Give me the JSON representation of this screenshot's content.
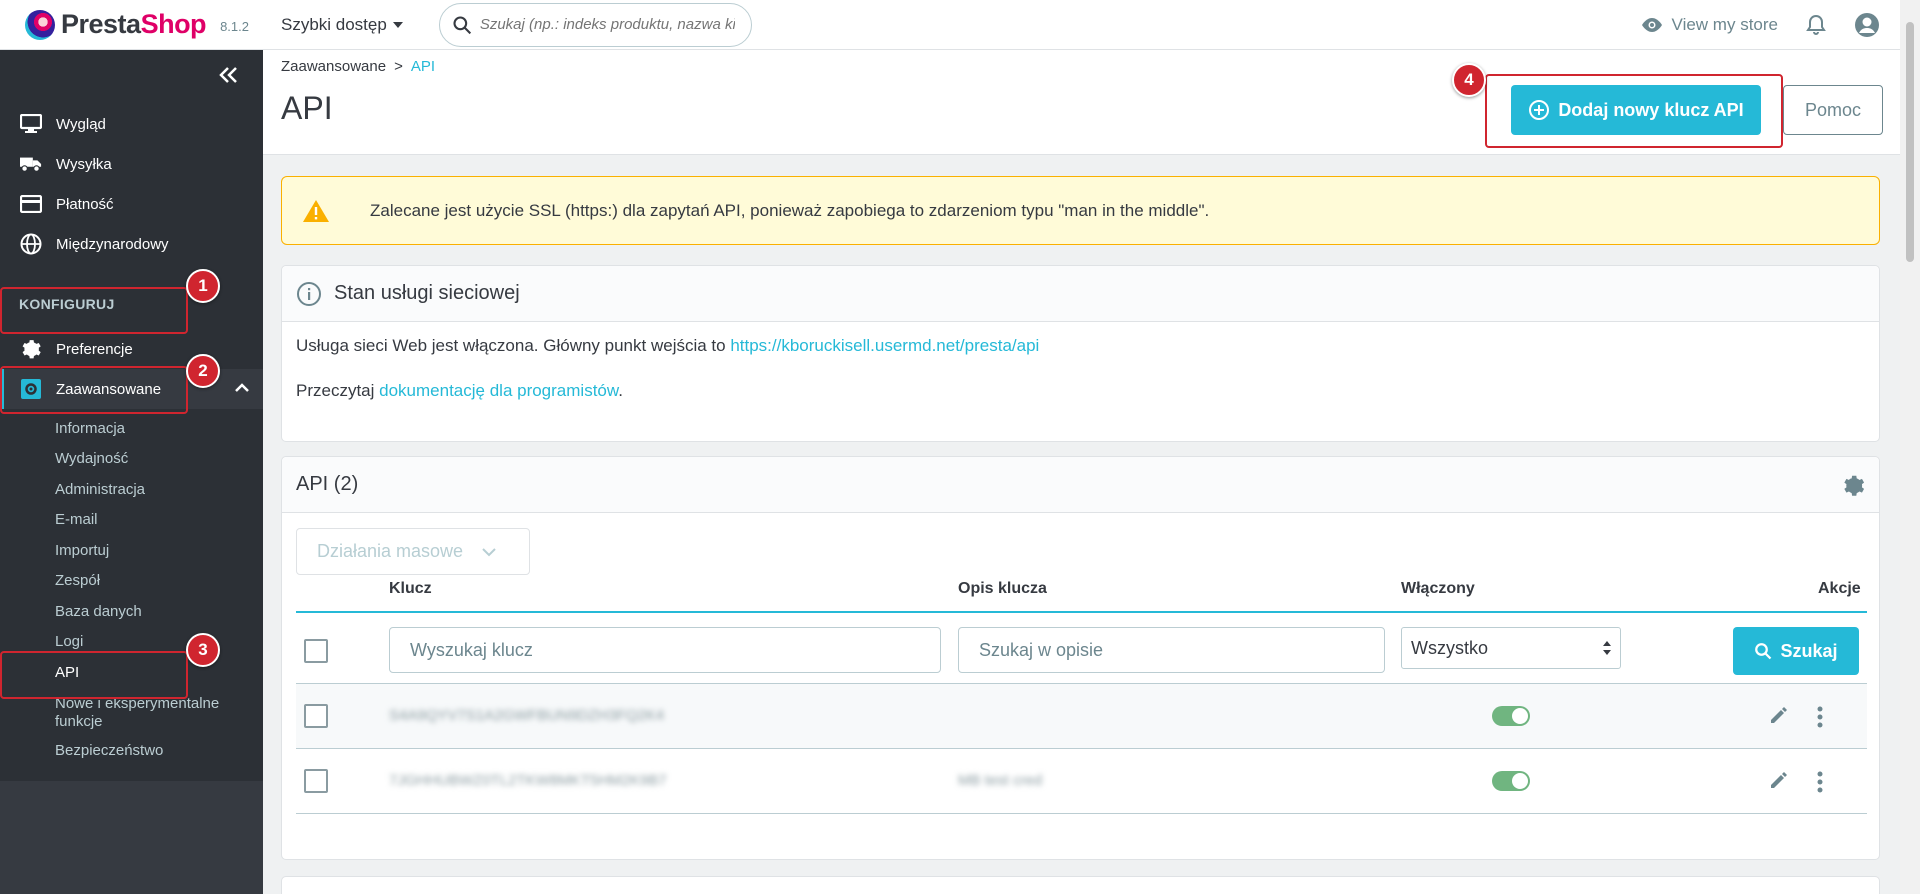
{
  "header": {
    "logo_presta": "Presta",
    "logo_shop": "Shop",
    "version": "8.1.2",
    "quick_access": "Szybki dostęp",
    "search_placeholder": "Szukaj (np.: indeks produktu, nazwa ki",
    "view_store": "View my store"
  },
  "sidebar": {
    "top_items": [
      {
        "label": "Wygląd",
        "icon": "monitor-icon"
      },
      {
        "label": "Wysyłka",
        "icon": "truck-icon"
      },
      {
        "label": "Płatność",
        "icon": "credit-card-icon"
      },
      {
        "label": "Międzynarodowy",
        "icon": "globe-icon"
      }
    ],
    "section_title": "KONFIGURUJ",
    "config_items": [
      {
        "label": "Preferencje",
        "icon": "gear-icon"
      },
      {
        "label": "Zaawansowane",
        "icon": "advanced-settings-icon"
      }
    ],
    "sub_items": [
      "Informacja",
      "Wydajność",
      "Administracja",
      "E-mail",
      "Importuj",
      "Zespół",
      "Baza danych",
      "Logi",
      "API",
      "Nowe i eksperymentalne funkcje",
      "Bezpieczeństwo"
    ]
  },
  "annotations": [
    "1",
    "2",
    "3",
    "4"
  ],
  "page": {
    "breadcrumb_parent": "Zaawansowane",
    "breadcrumb_sep": ">",
    "breadcrumb_current": "API",
    "title": "API",
    "add_button": "Dodaj nowy klucz API",
    "help_button": "Pomoc"
  },
  "alert": {
    "text": "Zalecane jest użycie SSL (https:) dla zapytań API, ponieważ zapobiega to zdarzeniom typu \"man in the middle\"."
  },
  "status_card": {
    "title": "Stan usługi sieciowej",
    "line1_prefix": "Usługa sieci Web jest włączona. Główny punkt wejścia to ",
    "line1_link": "https://kboruckisell.usermd.net/presta/api",
    "line2_prefix": "Przeczytaj ",
    "line2_link": "dokumentację dla programistów",
    "line2_suffix": "."
  },
  "api_card": {
    "title": "API (2)",
    "bulk_actions": "Działania masowe",
    "columns": {
      "key": "Klucz",
      "description": "Opis klucza",
      "enabled": "Włączony",
      "actions": "Akcje"
    },
    "filters": {
      "key_placeholder": "Wyszukaj klucz",
      "description_placeholder": "Szukaj w opisie",
      "enabled_value": "Wszystko",
      "search_button": "Szukaj"
    },
    "rows": [
      {
        "key": "S4A9QYV7S1A2GWFBUN9DZH3FQ2K4",
        "description": "",
        "enabled": true
      },
      {
        "key": "7JGHHUBWZ0TL2TKW8MKT5HM2K9B7",
        "description": "MB test cred",
        "enabled": true
      }
    ]
  }
}
